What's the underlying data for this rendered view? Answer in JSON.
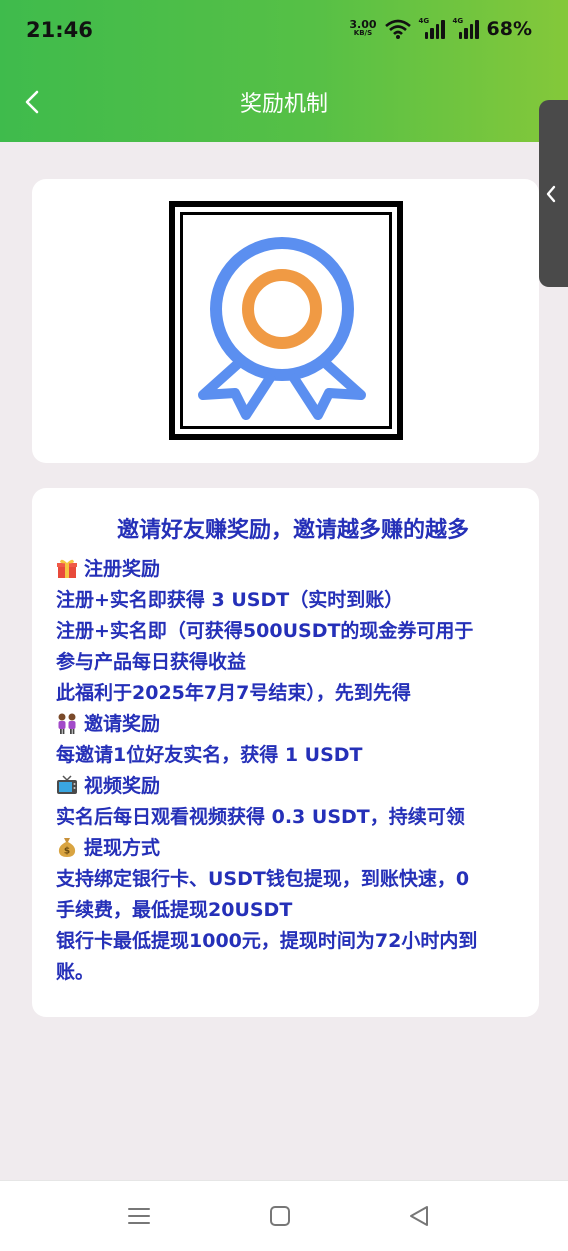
{
  "status_bar": {
    "time": "21:46",
    "net_speed_value": "3.00",
    "net_speed_unit": "KB/S",
    "sim1_tag": "4G",
    "sim2_tag": "4G",
    "battery": "68%"
  },
  "header": {
    "title": "奖励机制",
    "background_start": "#3fbb4c",
    "background_end": "#84c83a"
  },
  "content": {
    "headline": "邀请好友赚奖励，邀请越多赚的越多",
    "text_color": "#2530b8",
    "sections": {
      "register": {
        "icon": "gift-icon",
        "title": "注册奖励",
        "line1": "注册+实名即获得 3 USDT（实时到账）",
        "line2": "注册+实名即（可获得500USDT的现金券可用于",
        "line3": "参与产品每日获得收益",
        "line4": "此福利于2025年7月7号结束），先到先得"
      },
      "invite": {
        "icon": "two-women-icon",
        "title": "邀请奖励",
        "line1": "每邀请1位好友实名，获得 1 USDT"
      },
      "video": {
        "icon": "tv-icon",
        "title": "视频奖励",
        "line1": "实名后每日观看视频获得 0.3 USDT，持续可领"
      },
      "withdraw": {
        "icon": "money-bag-icon",
        "title": "提现方式",
        "line1": "支持绑定银行卡、USDT钱包提现，到账快速，0",
        "line2": "手续费，最低提现20USDT",
        "line3": "银行卡最低提现1000元，提现时间为72小时内到",
        "line4": "账。"
      }
    }
  },
  "icons": {
    "badge": "award-ribbon-icon",
    "badge_outer_color": "#5b8ff0",
    "badge_inner_color": "#f09a44"
  }
}
